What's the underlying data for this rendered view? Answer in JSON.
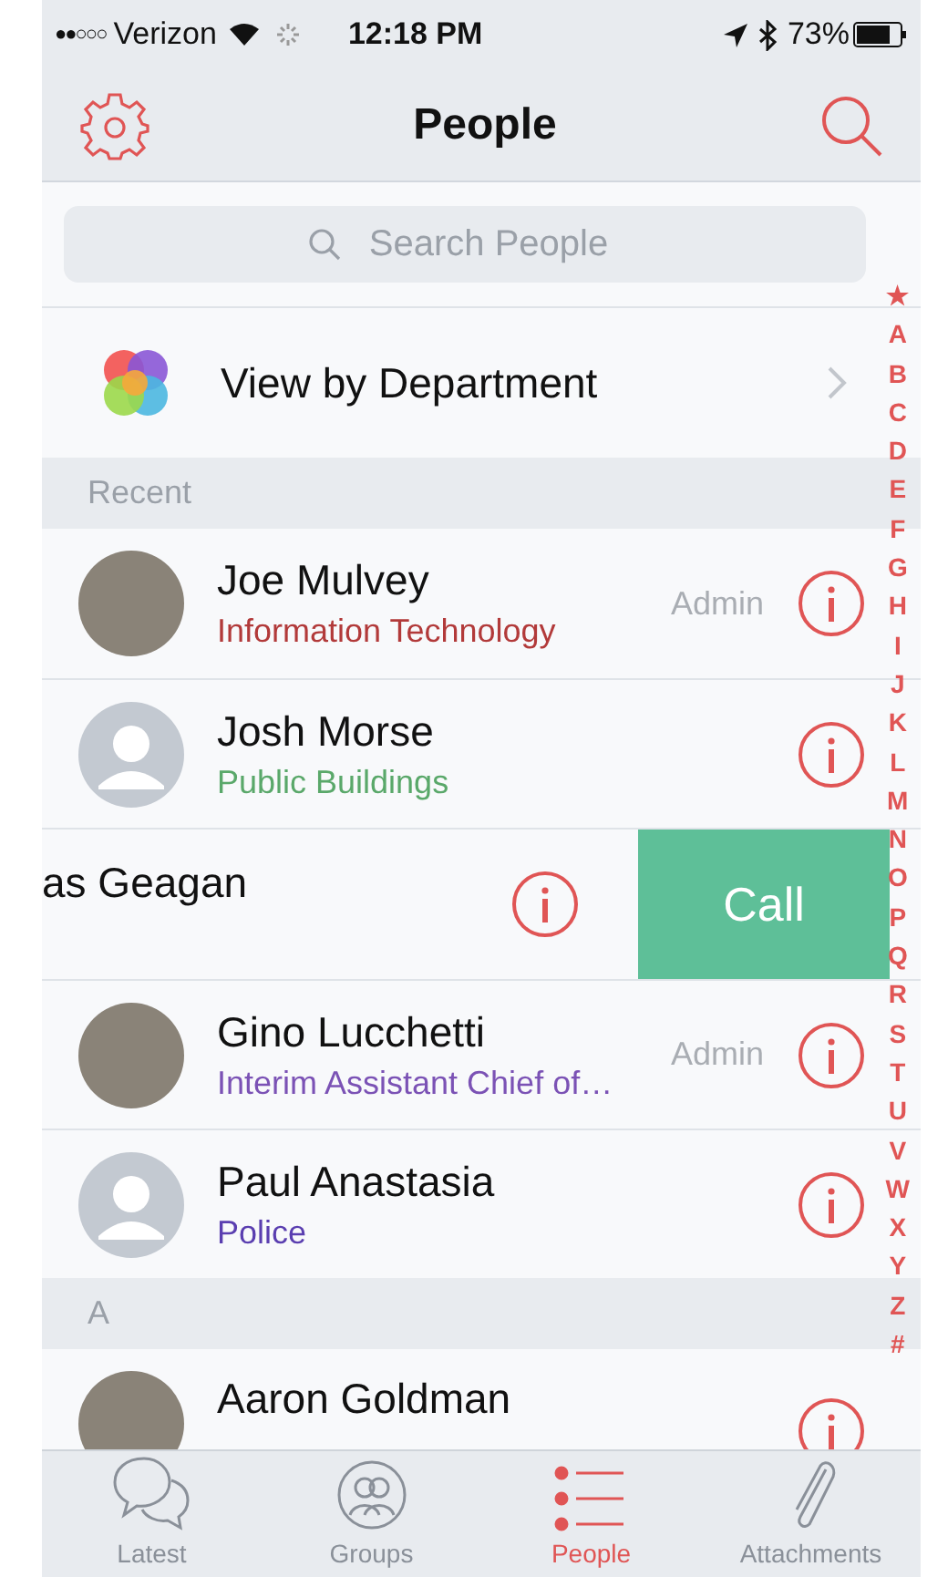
{
  "status_bar": {
    "signal": "●●○○○",
    "carrier": "Verizon",
    "time": "12:18 PM",
    "battery": "73%"
  },
  "nav": {
    "title": "People"
  },
  "search": {
    "placeholder": "Search People"
  },
  "department_link": {
    "label": "View by Department"
  },
  "sections": [
    {
      "header": "Recent",
      "rows": [
        {
          "kind": "normal",
          "avatar": {
            "kind": "photo"
          },
          "name": "Joe Mulvey",
          "department": "Information Technology",
          "color": "#b23a3a",
          "role": "Admin"
        },
        {
          "kind": "normal",
          "avatar": {
            "kind": "placeholder"
          },
          "name": "Josh Morse",
          "department": "Public Buildings",
          "color": "#5aa86a"
        },
        {
          "kind": "swiped",
          "name": "as Geagan",
          "action": "Call"
        },
        {
          "kind": "normal",
          "avatar": {
            "kind": "photo"
          },
          "name": "Gino Lucchetti",
          "department": "Interim Assistant Chief of…",
          "color": "#7b52b5",
          "role": "Admin"
        },
        {
          "kind": "normal",
          "avatar": {
            "kind": "placeholder"
          },
          "name": "Paul Anastasia",
          "department": "Police",
          "color": "#5a3eb0"
        }
      ]
    },
    {
      "header": "A",
      "rows": [
        {
          "kind": "cut",
          "avatar": {
            "kind": "photo"
          },
          "name": "Aaron Goldman"
        }
      ]
    }
  ],
  "index": [
    "★",
    "A",
    "B",
    "C",
    "D",
    "E",
    "F",
    "G",
    "H",
    "I",
    "J",
    "K",
    "L",
    "M",
    "N",
    "O",
    "P",
    "Q",
    "R",
    "S",
    "T",
    "U",
    "V",
    "W",
    "X",
    "Y",
    "Z",
    "#"
  ],
  "tabs": [
    {
      "label": "Latest",
      "kind": "chat",
      "selected": false
    },
    {
      "label": "Groups",
      "kind": "groups",
      "selected": false
    },
    {
      "label": "People",
      "kind": "list",
      "selected": true
    },
    {
      "label": "Attachments",
      "kind": "clip",
      "selected": false
    }
  ]
}
